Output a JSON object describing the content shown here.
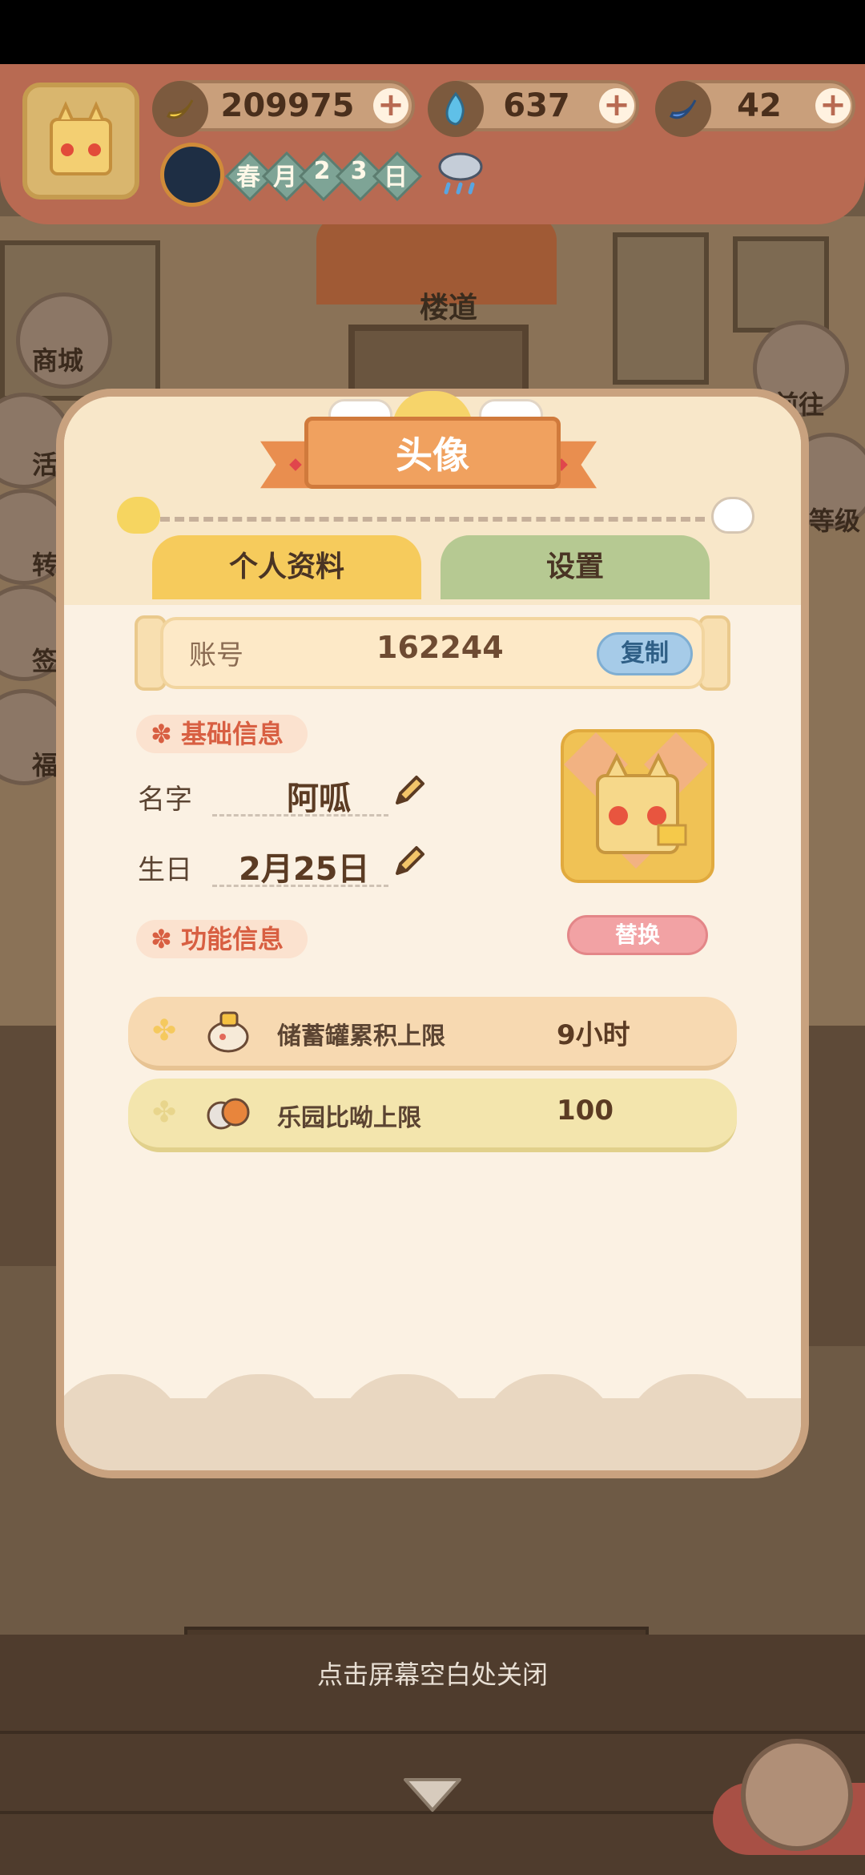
{
  "hud": {
    "bananas": "209975",
    "flames": "637",
    "gems": "42",
    "date": [
      "春",
      "月",
      "2",
      "3",
      "日"
    ],
    "weather_icon": "rain-cloud-icon"
  },
  "scene": {
    "door_label": "楼道",
    "left_buttons": [
      "商城",
      "活",
      "转",
      "签",
      "福"
    ],
    "right_buttons": [
      "前往",
      "等级"
    ]
  },
  "dialog": {
    "title": "头像",
    "tabs": [
      {
        "label": "个人资料",
        "active": true
      },
      {
        "label": "设置",
        "active": false
      }
    ],
    "account": {
      "label": "账号",
      "value": "162244",
      "copy_label": "复制"
    },
    "basic_section": "基础信息",
    "name": {
      "label": "名字",
      "value": "阿呱"
    },
    "birthday": {
      "label": "生日",
      "value": "2月25日"
    },
    "replace_label": "替换",
    "function_section": "功能信息",
    "features": [
      {
        "label": "储蓄罐累积上限",
        "value": "9小时"
      },
      {
        "label": "乐园比呦上限",
        "value": "100"
      }
    ]
  },
  "close_hint": "点击屏幕空白处关闭",
  "colors": {
    "accent": "#f0a15f",
    "tab_active": "#f6cb5c",
    "tab_inactive": "#b6c992",
    "replace": "#f2a2a4",
    "copy": "#a6cbe8"
  }
}
